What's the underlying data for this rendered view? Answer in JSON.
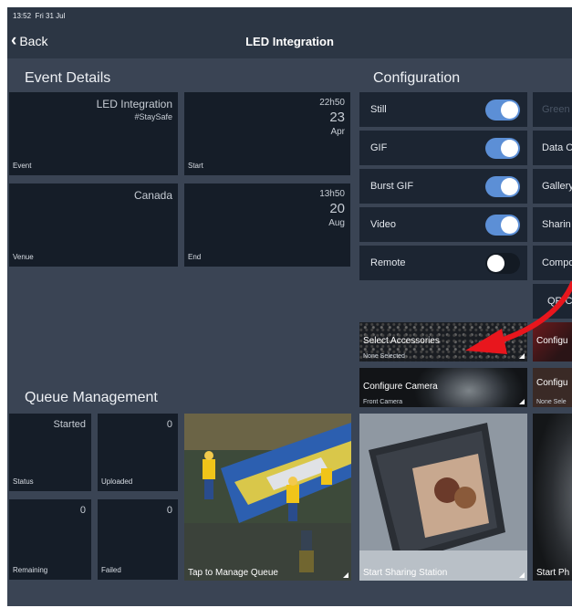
{
  "status": {
    "time": "13:52",
    "date": "Fri 31 Jul"
  },
  "nav": {
    "back_label": "Back",
    "title": "LED Integration"
  },
  "event_details": {
    "title": "Event Details",
    "event_name": "LED Integration",
    "event_tag": "#StaySafe",
    "event_label": "Event",
    "start_time": "22h50",
    "start_day": "23",
    "start_month": "Apr",
    "start_label": "Start",
    "venue_name": "Canada",
    "venue_label": "Venue",
    "end_time": "13h50",
    "end_day": "20",
    "end_month": "Aug",
    "end_label": "End"
  },
  "configuration": {
    "title": "Configuration",
    "rows": [
      {
        "label": "Still",
        "on": true
      },
      {
        "label": "GIF",
        "on": true
      },
      {
        "label": "Burst GIF",
        "on": true
      },
      {
        "label": "Video",
        "on": true
      },
      {
        "label": "Remote",
        "on": false
      }
    ],
    "side_items": [
      "Green",
      "Data C",
      "Gallery",
      "Sharin",
      "Compo",
      "QR Co"
    ],
    "tiles": {
      "accessories_title": "Select Accessories",
      "accessories_sub": "None Selected",
      "camera_title": "Configure Camera",
      "camera_sub": "Front Camera",
      "side_config_1": "Configu",
      "side_config_2": "Configu",
      "side_config_2_sub": "None Sele"
    }
  },
  "queue": {
    "title": "Queue Management",
    "status_value": "Started",
    "status_label": "Status",
    "uploaded_value": "0",
    "uploaded_label": "Uploaded",
    "remaining_value": "0",
    "remaining_label": "Remaining",
    "failed_value": "0",
    "failed_label": "Failed",
    "manage_label": "Tap to Manage Queue"
  },
  "actions": {
    "sharing_station": "Start Sharing Station",
    "start_ph": "Start Ph"
  },
  "colors": {
    "toggle_on": "#5c8fd6",
    "arrow": "#e8161d",
    "background": "#3a4454"
  }
}
